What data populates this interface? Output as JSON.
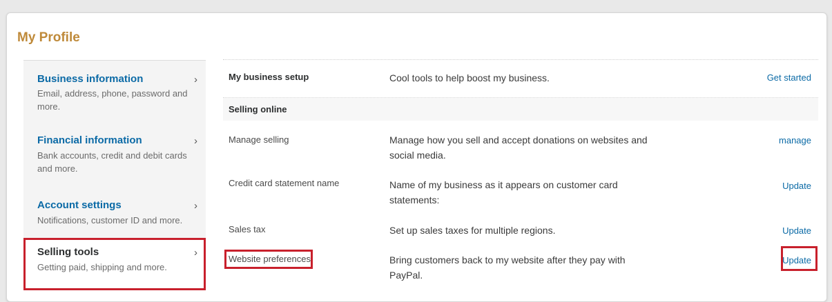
{
  "page": {
    "title": "My Profile"
  },
  "sidebar": {
    "items": [
      {
        "title": "Business information",
        "desc": "Email, address, phone, password and more."
      },
      {
        "title": "Financial information",
        "desc": "Bank accounts, credit and debit cards and more."
      },
      {
        "title": "Account settings",
        "desc": "Notifications, customer ID and more."
      },
      {
        "title": "Selling tools",
        "desc": "Getting paid, shipping and more."
      }
    ],
    "chevron": "›"
  },
  "content": {
    "setup": {
      "label": "My business setup",
      "desc": "Cool tools to help boost my business.",
      "action": "Get started"
    },
    "section": {
      "label": "Selling online"
    },
    "rows": [
      {
        "label": "Manage selling",
        "desc": "Manage how you sell and accept donations on websites and social media.",
        "action": "manage"
      },
      {
        "label": "Credit card statement name",
        "desc": "Name of my business as it appears on customer card statements:",
        "action": "Update"
      },
      {
        "label": "Sales tax",
        "desc": "Set up sales taxes for multiple regions.",
        "action": "Update"
      },
      {
        "label": "Website preferences",
        "desc": "Bring customers back to my website after they pay with PayPal.",
        "action": "Update"
      }
    ]
  },
  "colors": {
    "title": "#bf8a3a",
    "link": "#0b6aa6",
    "highlight": "#c8202c"
  }
}
